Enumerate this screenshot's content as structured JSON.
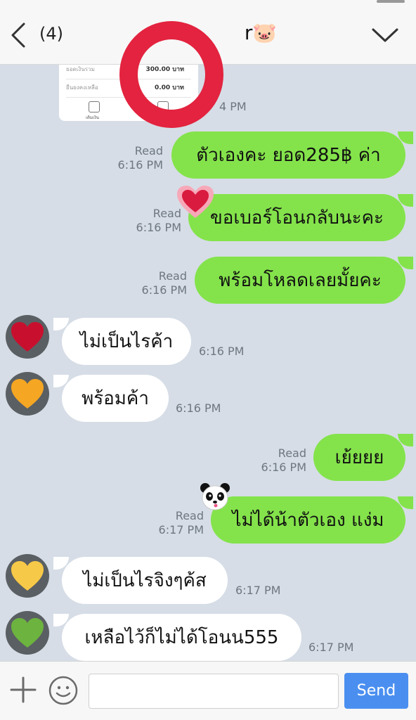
{
  "header": {
    "unread_count": "(4)",
    "title": "r🐷"
  },
  "receipt": {
    "row1_label": "ยอดเงินรวม",
    "row1_value": "300.00 บาท",
    "row2_label": "ยืนยงคงเหลือ",
    "row2_value": "0.00 บาท",
    "icon1_caption": "เติมเงิน",
    "partial_time": "4 PM"
  },
  "messages": [
    {
      "dir": "out",
      "text": "ตัวเองคะ ยอด285฿ ค่า",
      "read": "Read",
      "time": "6:16 PM"
    },
    {
      "dir": "out",
      "text": "ขอเบอร์โอนกลับนะคะ",
      "read": "Read",
      "time": "6:16 PM"
    },
    {
      "dir": "out",
      "text": "พร้อมโหลดเลยมั้ยคะ",
      "read": "Read",
      "time": "6:16 PM"
    },
    {
      "dir": "in",
      "text": "ไม่เป็นไรค้า",
      "time": "6:16 PM"
    },
    {
      "dir": "in",
      "text": "พร้อมค้า",
      "time": "6:16 PM"
    },
    {
      "dir": "out",
      "text": "เย้ยยย",
      "read": "Read",
      "time": "6:16 PM"
    },
    {
      "dir": "out",
      "text": "ไม่ได้น้าตัวเอง แง่ม",
      "read": "Read",
      "time": "6:17 PM"
    },
    {
      "dir": "in",
      "text": "ไม่เป็นไรจิงๆค้ส",
      "time": "6:17 PM"
    },
    {
      "dir": "in",
      "text": "เหลือไว้ก็ไม่ได้โอนน555",
      "time": "6:17 PM"
    }
  ],
  "avatars": [
    {
      "heart_color": "#c8102e"
    },
    {
      "heart_color": "#f5a623"
    },
    {
      "heart_color": "#f7c948"
    },
    {
      "heart_color": "#6db33f"
    }
  ],
  "input": {
    "placeholder": "",
    "send_label": "Send"
  }
}
